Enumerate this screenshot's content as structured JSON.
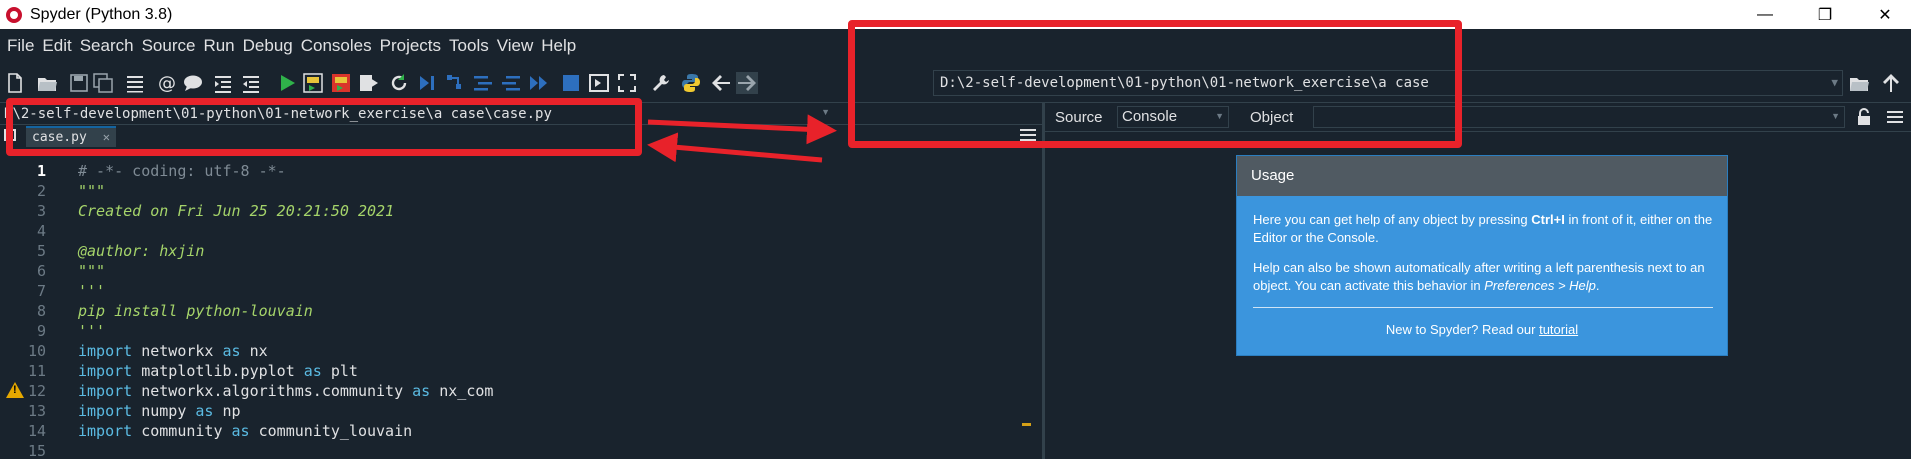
{
  "window": {
    "title": "Spyder (Python 3.8)",
    "minimize": "—",
    "maximize": "❐",
    "close": "✕"
  },
  "menubar": [
    "File",
    "Edit",
    "Search",
    "Source",
    "Run",
    "Debug",
    "Consoles",
    "Projects",
    "Tools",
    "View",
    "Help"
  ],
  "toolbar": {
    "icons": [
      "new-file-icon",
      "open-folder-icon",
      "save-icon",
      "save-all-icon",
      "outline-icon",
      "at-icon",
      "comment-icon",
      "indent-icon",
      "unindent-icon",
      "run-icon",
      "run-cell-icon",
      "run-cell-advance-icon",
      "run-selection-icon",
      "rerun-icon",
      "debug-step-icon",
      "debug-icon",
      "debug-continue-icon",
      "debug-next-icon",
      "stop-icon",
      "maximize-pane-icon",
      "fullscreen-icon",
      "wrench-icon",
      "python-icon"
    ],
    "working_directory": "D:\\2-self-development\\01-python\\01-network_exercise\\a case"
  },
  "editor": {
    "file_path": "\\2-self-development\\01-python\\01-network_exercise\\a case\\case.py",
    "path_prefix": "D",
    "tab_label": "case.py",
    "tab_close": "✕",
    "current_line": 1,
    "warning_line": 12,
    "lines": [
      {
        "n": "1",
        "parts": [
          {
            "t": "# -*- coding: utf-8 -*-",
            "c": "c-comment"
          }
        ]
      },
      {
        "n": "2",
        "parts": [
          {
            "t": "\"\"\"",
            "c": "c-green"
          }
        ]
      },
      {
        "n": "3",
        "parts": [
          {
            "t": "Created on Fri Jun 25 20:21:50 2021",
            "c": "c-green"
          }
        ]
      },
      {
        "n": "4",
        "parts": []
      },
      {
        "n": "5",
        "parts": [
          {
            "t": "@author: hxjin",
            "c": "c-green"
          }
        ]
      },
      {
        "n": "6",
        "parts": [
          {
            "t": "\"\"\"",
            "c": "c-green"
          }
        ]
      },
      {
        "n": "7",
        "parts": [
          {
            "t": "'''",
            "c": "c-green"
          }
        ]
      },
      {
        "n": "8",
        "parts": [
          {
            "t": "pip install python-louvain",
            "c": "c-green"
          }
        ]
      },
      {
        "n": "9",
        "parts": [
          {
            "t": "'''",
            "c": "c-green"
          }
        ]
      },
      {
        "n": "10",
        "parts": [
          {
            "t": "import",
            "c": "c-kw"
          },
          {
            "t": " networkx ",
            "c": "c-plain"
          },
          {
            "t": "as",
            "c": "c-kw"
          },
          {
            "t": " nx",
            "c": "c-plain"
          }
        ]
      },
      {
        "n": "11",
        "parts": [
          {
            "t": "import",
            "c": "c-kw"
          },
          {
            "t": " matplotlib.pyplot ",
            "c": "c-plain"
          },
          {
            "t": "as",
            "c": "c-kw"
          },
          {
            "t": " plt",
            "c": "c-plain"
          }
        ]
      },
      {
        "n": "12",
        "parts": [
          {
            "t": "import",
            "c": "c-kw"
          },
          {
            "t": " networkx.algorithms.community ",
            "c": "c-plain"
          },
          {
            "t": "as",
            "c": "c-kw"
          },
          {
            "t": " nx_com",
            "c": "c-plain"
          }
        ]
      },
      {
        "n": "13",
        "parts": [
          {
            "t": "import",
            "c": "c-kw"
          },
          {
            "t": " numpy ",
            "c": "c-plain"
          },
          {
            "t": "as",
            "c": "c-kw"
          },
          {
            "t": " np",
            "c": "c-plain"
          }
        ]
      },
      {
        "n": "14",
        "parts": [
          {
            "t": "import",
            "c": "c-kw"
          },
          {
            "t": " community ",
            "c": "c-plain"
          },
          {
            "t": "as",
            "c": "c-kw"
          },
          {
            "t": " community_louvain",
            "c": "c-plain"
          }
        ]
      },
      {
        "n": "15",
        "parts": []
      }
    ]
  },
  "help": {
    "source_label": "Source",
    "source_value": "Console",
    "object_label": "Object",
    "object_value": "",
    "usage": {
      "heading": "Usage",
      "para1_before": "Here you can get help of any object by pressing ",
      "para1_key": "Ctrl+I",
      "para1_after": " in front of it, either on the Editor or the Console.",
      "para2_before": "Help can also be shown automatically after writing a left parenthesis next to an object. You can activate this behavior in ",
      "para2_em": "Preferences > Help",
      "para2_after": ".",
      "footer_text": "New to Spyder? Read our ",
      "footer_link": "tutorial"
    }
  },
  "colors": {
    "background": "#19232d",
    "annotation_red": "#e8222a",
    "usage_blue": "#3b95dd"
  }
}
